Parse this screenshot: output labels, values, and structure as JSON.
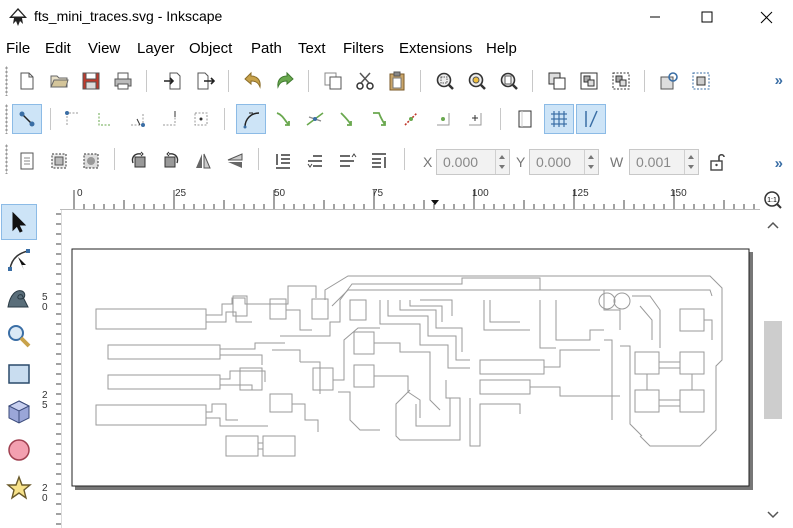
{
  "window": {
    "title": "fts_mini_traces.svg - Inkscape",
    "controls": [
      "minimize-icon",
      "maximize-icon",
      "close-icon"
    ]
  },
  "menu": {
    "items": [
      {
        "label": "File",
        "name": "menu-file"
      },
      {
        "label": "Edit",
        "name": "menu-edit"
      },
      {
        "label": "View",
        "name": "menu-view"
      },
      {
        "label": "Layer",
        "name": "menu-layer"
      },
      {
        "label": "Object",
        "name": "menu-object"
      },
      {
        "label": "Path",
        "name": "menu-path"
      },
      {
        "label": "Text",
        "name": "menu-text"
      },
      {
        "label": "Filters",
        "name": "menu-filters"
      },
      {
        "label": "Extensions",
        "name": "menu-extensions"
      },
      {
        "label": "Help",
        "name": "menu-help"
      }
    ]
  },
  "commands_bar": {
    "icons": [
      "new-document-icon",
      "open-icon",
      "save-icon",
      "print-icon",
      "import-icon",
      "export-icon",
      "undo-icon",
      "redo-icon",
      "copy-icon",
      "cut-icon",
      "paste-icon",
      "zoom-selection-icon",
      "zoom-drawing-icon",
      "zoom-page-icon",
      "duplicate-icon",
      "group-icon",
      "ungroup-icon",
      "fill-stroke-icon",
      "align-icon"
    ],
    "overflow": "»"
  },
  "snap_bar": {
    "icons": [
      "snap-toggle-icon",
      "snap-bbox-icon",
      "snap-bbox-edge-icon",
      "snap-bbox-corner-icon",
      "snap-bbox-midpoint-icon",
      "snap-bbox-center-icon",
      "snap-nodes-icon",
      "snap-path-icon",
      "snap-intersection-icon",
      "snap-cusp-icon",
      "snap-smooth-icon",
      "snap-midpoint-icon",
      "snap-object-center-icon",
      "snap-rotation-center-icon",
      "snap-page-border-icon",
      "snap-grid-icon",
      "snap-guide-icon"
    ],
    "active": [
      "snap-toggle-icon",
      "snap-cusp-icon",
      "snap-grid-icon",
      "snap-guide-icon"
    ]
  },
  "tool_controls": {
    "icons": [
      "select-all-icon",
      "select-all-layers-icon",
      "deselect-icon",
      "rotate-ccw-icon",
      "rotate-cw-icon",
      "flip-horizontal-icon",
      "flip-vertical-icon",
      "lower-bottom-icon",
      "lower-icon",
      "raise-icon",
      "raise-top-icon"
    ],
    "x": {
      "label": "X",
      "value": "0.000"
    },
    "y": {
      "label": "Y",
      "value": "0.000"
    },
    "w": {
      "label": "W",
      "value": "0.001"
    },
    "lock_icon": "lock-icon",
    "overflow": "»"
  },
  "ruler": {
    "horizontal": [
      "0",
      "25",
      "50",
      "75",
      "100",
      "125",
      "150"
    ],
    "vertical": [
      "5",
      "0",
      "2",
      "5",
      "2",
      "0"
    ]
  },
  "tools": [
    "selector-tool-icon",
    "node-tool-icon",
    "tweak-tool-icon",
    "zoom-tool-icon",
    "rectangle-tool-icon",
    "3d-box-tool-icon",
    "ellipse-tool-icon",
    "star-tool-icon"
  ],
  "zoom_fit": "1:1",
  "colors": {
    "accent": "#cde4f7",
    "accent_border": "#8cbbe6",
    "trace": "#9a9a9a",
    "save_red": "#c0392b",
    "undo_gold": "#c8a24a",
    "redo_green": "#6aa84f"
  }
}
